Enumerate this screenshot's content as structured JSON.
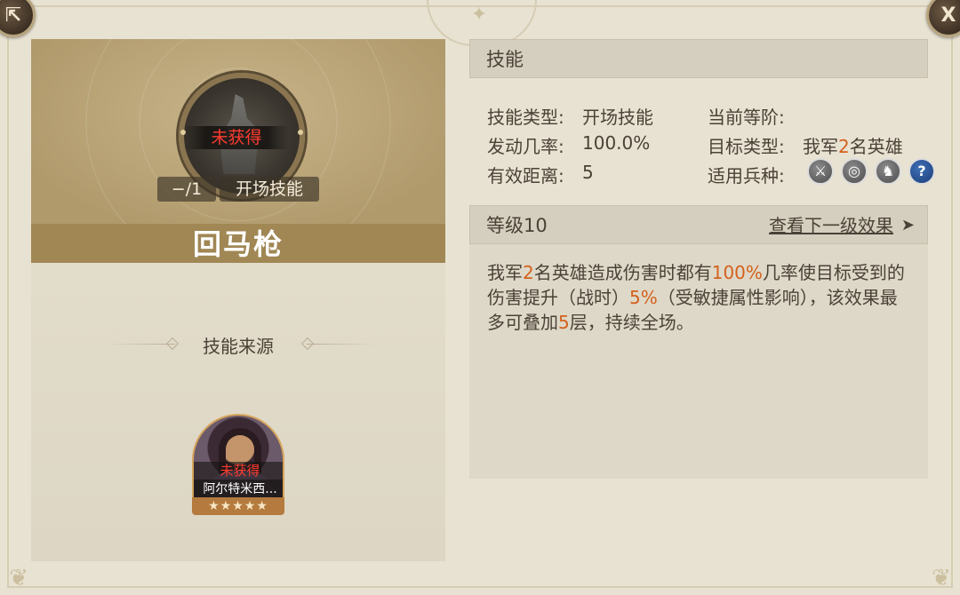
{
  "skill": {
    "name": "回马枪",
    "obtained_status": "未获得",
    "count": "−/1",
    "type_tag": "开场技能"
  },
  "source": {
    "title": "技能来源",
    "hero": {
      "status": "未获得",
      "name": "阿尔特米西...",
      "stars": "★★★★★",
      "star_count": 5
    }
  },
  "skill_panel": {
    "header": "技能",
    "rows": {
      "skill_type_label": "技能类型:",
      "skill_type_value": "开场技能",
      "current_rank_label": "当前等阶:",
      "current_rank_value": "",
      "trigger_rate_label": "发动几率:",
      "trigger_rate_value": "100.0%",
      "target_type_label": "目标类型:",
      "target_type_prefix": "我军",
      "target_type_number": "2",
      "target_type_suffix": "名英雄",
      "range_label": "有效距离:",
      "range_value": "5",
      "troop_label": "适用兵种:"
    },
    "troop_icons": [
      "sword-icon",
      "archery-target-icon",
      "horse-icon",
      "question-icon"
    ]
  },
  "level_panel": {
    "header": "等级10",
    "next_link": "查看下一级效果",
    "arrow": "➤"
  },
  "description": {
    "p1": "我军",
    "n1": "2",
    "p2": "名英雄造成伤害时都有",
    "n2": "100%",
    "p3": "几率使目标受到的伤害提升（战时）",
    "n3": "5%",
    "p4": "（受敏捷属性影响），该效果最多可叠加",
    "n4": "5",
    "p5": "层，持续全场。"
  },
  "colors": {
    "highlight": "#d4611d",
    "unobtained": "#ff3b2f",
    "name_bar": "#a08754"
  }
}
